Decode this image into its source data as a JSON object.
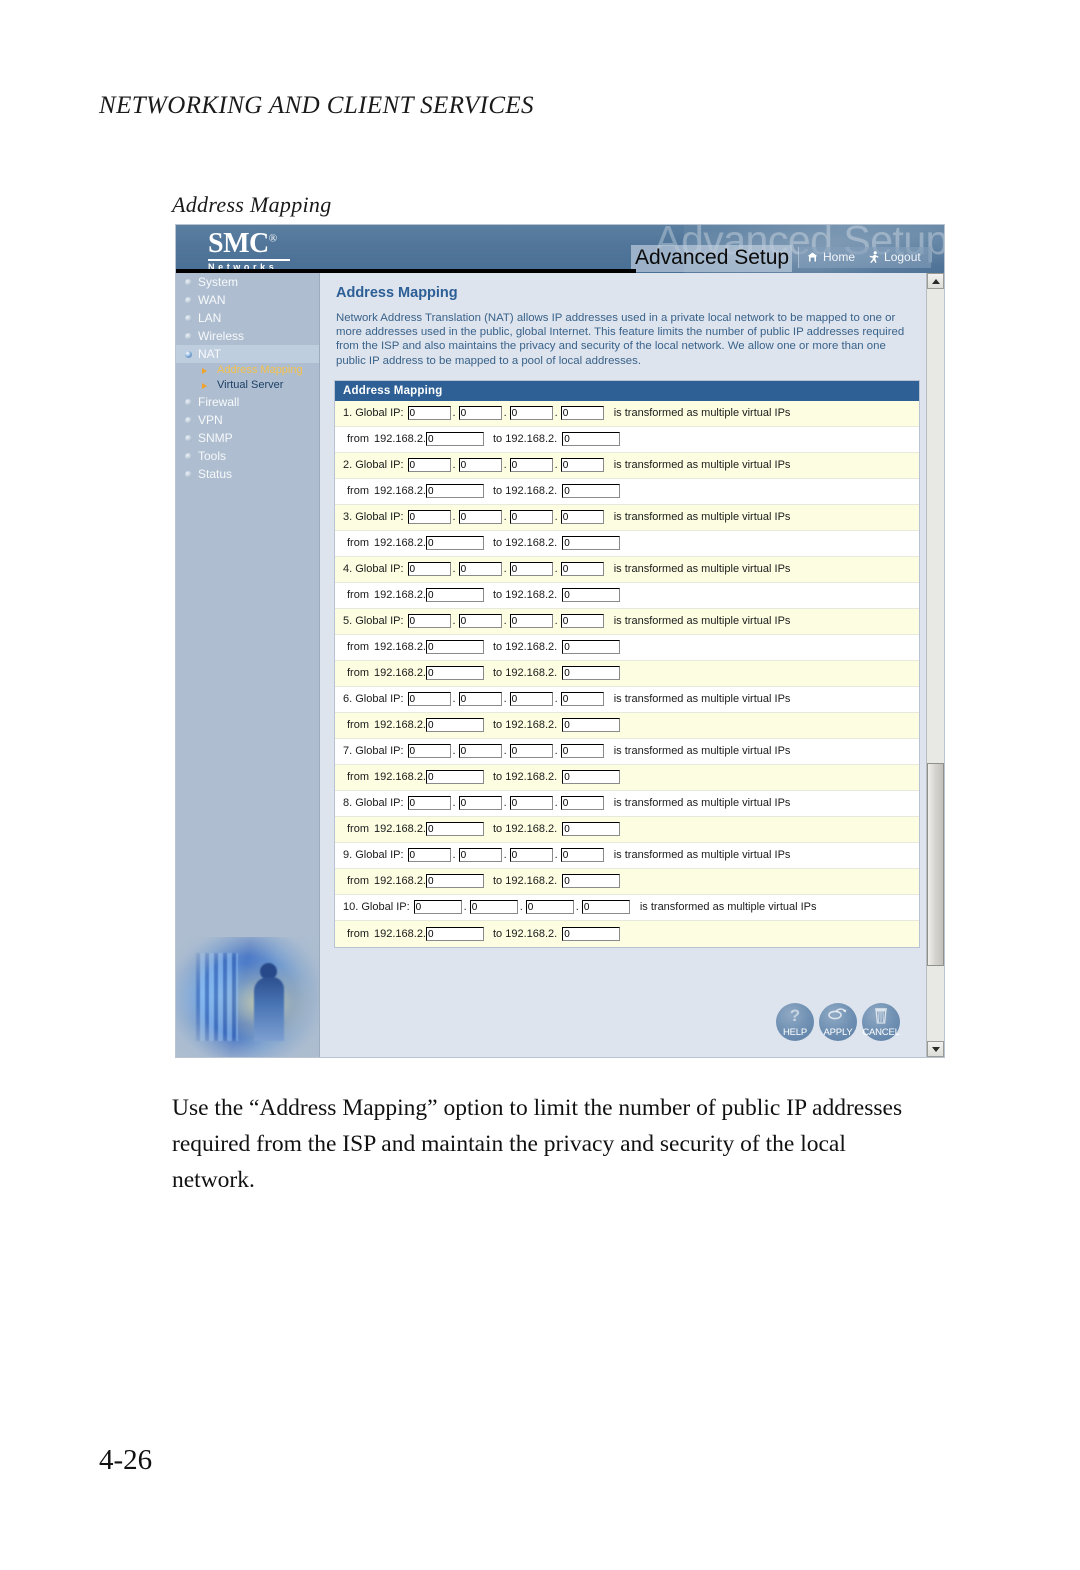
{
  "document": {
    "running_header": "NETWORKING AND CLIENT SERVICES",
    "section_title": "Address Mapping",
    "body_text": "Use the “Address Mapping” option to limit the number of public IP addresses required from the ISP and maintain the privacy and security of the local network.",
    "page_number": "4-26"
  },
  "screenshot": {
    "banner": {
      "logo_word": "SMC",
      "logo_reg": "®",
      "logo_sub": "Networks",
      "watermark": "Advanced Setup",
      "title": "Advanced Setup",
      "home_label": "Home",
      "logout_label": "Logout"
    },
    "sidebar": {
      "items": [
        {
          "label": "System",
          "active": false
        },
        {
          "label": "WAN",
          "active": false
        },
        {
          "label": "LAN",
          "active": false
        },
        {
          "label": "Wireless",
          "active": false
        },
        {
          "label": "NAT",
          "active": true
        }
      ],
      "subitems": [
        {
          "label": "Address Mapping",
          "selected": true
        },
        {
          "label": "Virtual Server",
          "selected": false
        }
      ],
      "items_after": [
        {
          "label": "Firewall",
          "active": false
        },
        {
          "label": "VPN",
          "active": false
        },
        {
          "label": "SNMP",
          "active": false
        },
        {
          "label": "Tools",
          "active": false
        },
        {
          "label": "Status",
          "active": false
        }
      ]
    },
    "content": {
      "page_title": "Address Mapping",
      "description": "Network Address Translation (NAT) allows IP addresses used in a private local network to be mapped to one or more addresses used in the public, global Internet. This feature limits the number of public IP addresses required from the ISP and also maintains the privacy and security of the local network. We allow one or more than one public IP address to be mapped to a pool of local addresses.",
      "panel_header": "Address Mapping",
      "labels": {
        "global_ip": "Global IP:",
        "transformed": "is transformed as multiple virtual IPs",
        "from": "from",
        "to": "to",
        "subnet_prefix": "192.168.2.",
        "dot": "."
      },
      "entries": [
        {
          "index": "1.",
          "global_ip": [
            "0",
            "0",
            "0",
            "0"
          ],
          "pools": [
            {
              "from": "0",
              "to": "0"
            }
          ]
        },
        {
          "index": "2.",
          "global_ip": [
            "0",
            "0",
            "0",
            "0"
          ],
          "pools": [
            {
              "from": "0",
              "to": "0"
            }
          ]
        },
        {
          "index": "3.",
          "global_ip": [
            "0",
            "0",
            "0",
            "0"
          ],
          "pools": [
            {
              "from": "0",
              "to": "0"
            }
          ]
        },
        {
          "index": "4.",
          "global_ip": [
            "0",
            "0",
            "0",
            "0"
          ],
          "pools": [
            {
              "from": "0",
              "to": "0"
            }
          ]
        },
        {
          "index": "5.",
          "global_ip": [
            "0",
            "0",
            "0",
            "0"
          ],
          "pools": [
            {
              "from": "0",
              "to": "0"
            },
            {
              "from": "0",
              "to": "0"
            }
          ]
        },
        {
          "index": "6.",
          "global_ip": [
            "0",
            "0",
            "0",
            "0"
          ],
          "pools": [
            {
              "from": "0",
              "to": "0"
            }
          ]
        },
        {
          "index": "7.",
          "global_ip": [
            "0",
            "0",
            "0",
            "0"
          ],
          "pools": [
            {
              "from": "0",
              "to": "0"
            }
          ]
        },
        {
          "index": "8.",
          "global_ip": [
            "0",
            "0",
            "0",
            "0"
          ],
          "pools": [
            {
              "from": "0",
              "to": "0"
            }
          ]
        },
        {
          "index": "9.",
          "global_ip": [
            "0",
            "0",
            "0",
            "0"
          ],
          "pools": [
            {
              "from": "0",
              "to": "0"
            }
          ]
        },
        {
          "index": "10.",
          "global_ip": [
            "0",
            "0",
            "0",
            "0"
          ],
          "pools": [
            {
              "from": "0",
              "to": "0"
            }
          ]
        }
      ],
      "buttons": [
        {
          "label": "HELP",
          "icon": "question-mark-icon"
        },
        {
          "label": "APPLY",
          "icon": "disk-arrow-icon"
        },
        {
          "label": "CANCEL",
          "icon": "trash-can-icon"
        }
      ]
    },
    "colors": {
      "banner_blue": "#51769a",
      "sidebar_blue": "#aebed0",
      "panel_header_blue": "#2e6096",
      "content_bg": "#dde4ee",
      "row_tint": "#fdfde2",
      "title_blue": "#2c5f96",
      "highlight_orange": "#f5c14b"
    }
  }
}
